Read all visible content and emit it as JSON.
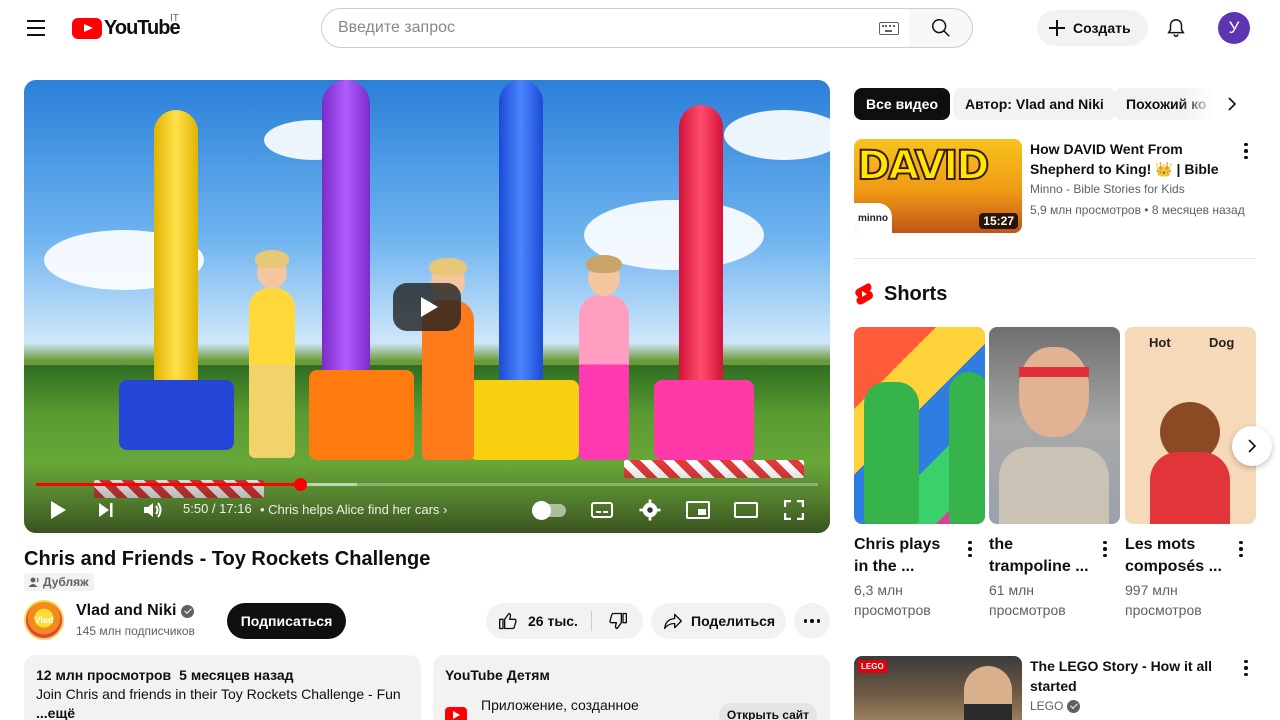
{
  "masthead": {
    "logo_text": "YouTube",
    "country_code": "IT",
    "search_placeholder": "Введите запрос",
    "create_label": "Создать",
    "avatar_letter": "У"
  },
  "player": {
    "current_time": "5:50",
    "duration": "17:16",
    "time_display": "5:50 / 17:16",
    "chapter_title": "Chris helps Alice find her cars",
    "progress_fraction": 0.338,
    "buffer_fraction": 0.41,
    "accent_color": "#ff0000"
  },
  "video": {
    "title": "Chris and Friends - Toy Rockets Challenge",
    "dub_badge": "Дубляж",
    "channel_name": "Vlad and Niki",
    "channel_avatar_text": "Vlad Niki",
    "subscribers": "145 млн подписчиков",
    "subscribe_label": "Подписаться",
    "likes": "26 тыс.",
    "share_label": "Поделиться"
  },
  "description": {
    "views": "12 млн просмотров",
    "date": "5 месяцев назад",
    "text": "Join Chris and friends in their Toy Rockets Challenge - Fun",
    "more": "...ещё"
  },
  "kids_card": {
    "title": "YouTube Детям",
    "text": "Приложение, созданное",
    "button": "Открыть сайт"
  },
  "chips": [
    "Все видео",
    "Автор: Vlad and Niki",
    "Похожий ко"
  ],
  "recommended": [
    {
      "title": "How DAVID Went From Shepherd to King! 👑 | Bible ...",
      "thumb_word": "DAVID",
      "thumb_brand": "minno",
      "channel": "Minno - Bible Stories for Kids",
      "meta": "5,9 млн просмотров • 8 месяцев назад",
      "duration": "15:27"
    },
    {
      "title": "The LEGO Story - How it all started",
      "thumb_brand": "LEGO",
      "channel": "LEGO"
    }
  ],
  "shorts": {
    "heading": "Shorts",
    "items": [
      {
        "title": "Chris plays in the ...",
        "views": "6,3 млн просмотров"
      },
      {
        "title": "the trampoline ...",
        "views": "61 млн просмотров"
      },
      {
        "title": "Les mots composés ...",
        "views": "997 млн просмотров",
        "thumb_word_1": "Hot",
        "thumb_word_2": "Dog"
      }
    ]
  }
}
